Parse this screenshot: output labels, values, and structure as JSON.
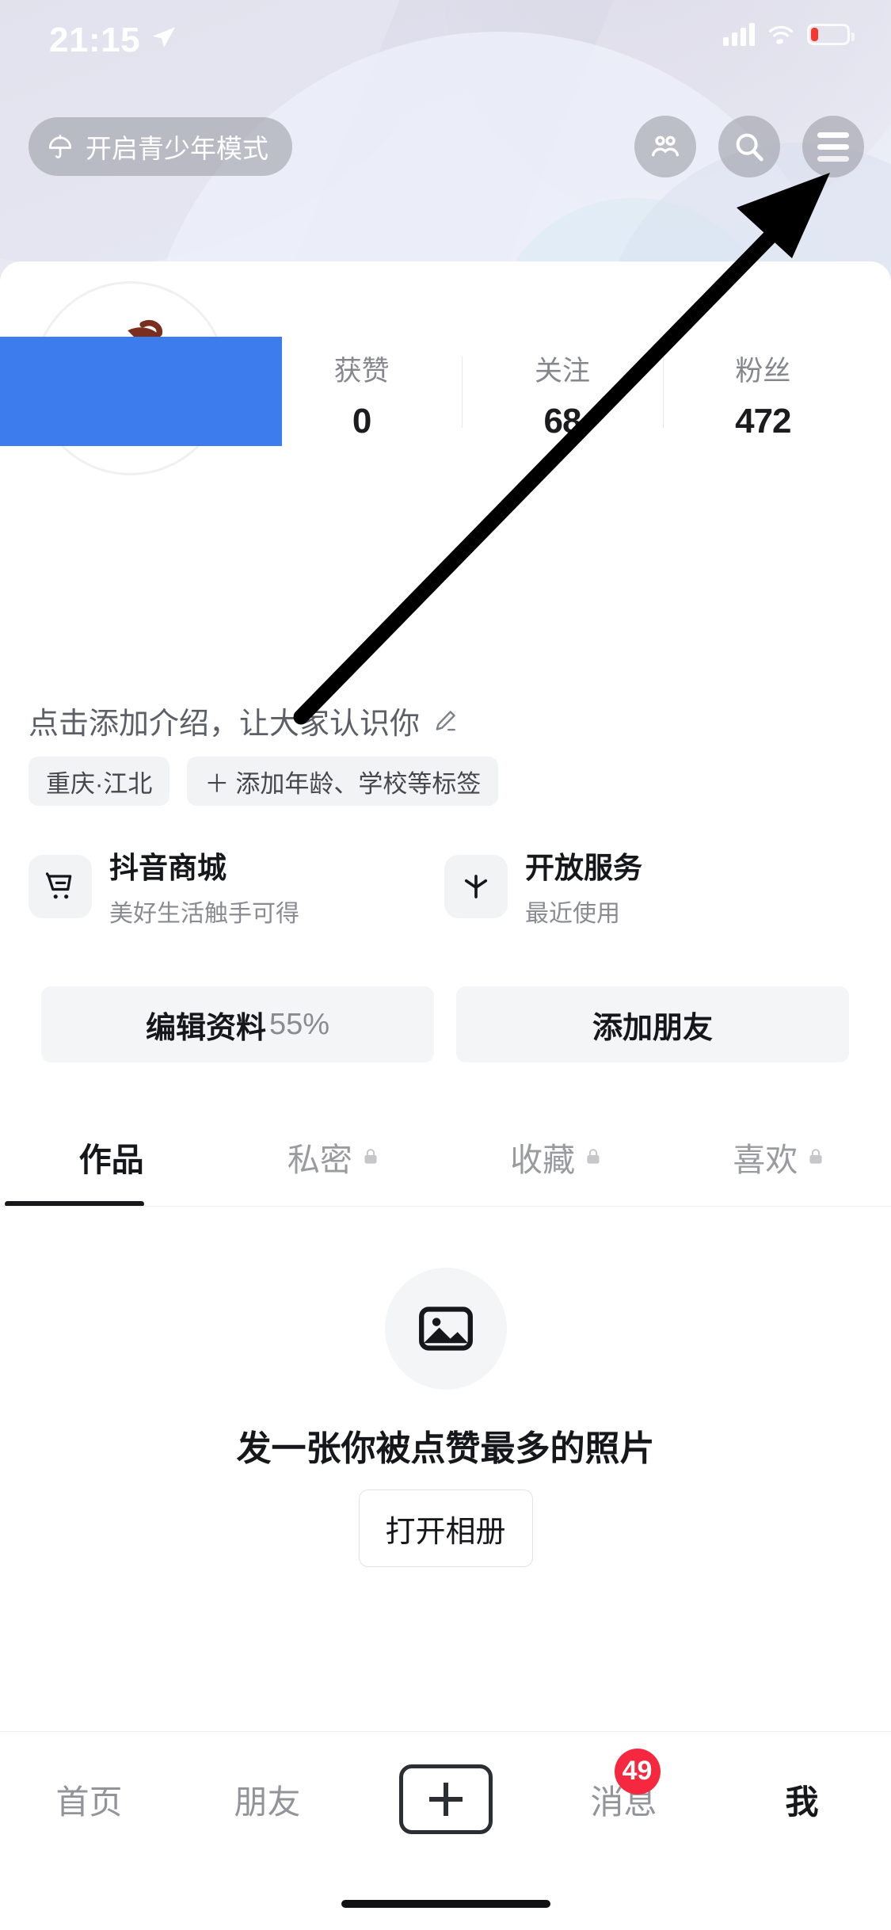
{
  "status_bar": {
    "time": "21:15",
    "location_icon": "location-arrow-icon",
    "signal_icon": "cellular-signal-icon",
    "wifi_icon": "wifi-icon",
    "battery_icon": "battery-low-icon",
    "battery_color": "#f5382e"
  },
  "header": {
    "teen_mode_label": "开启青少年模式",
    "teen_mode_icon": "umbrella-icon",
    "buttons": [
      {
        "name": "friends-icon",
        "label": ""
      },
      {
        "name": "search-icon",
        "label": ""
      },
      {
        "name": "menu-icon",
        "label": ""
      }
    ]
  },
  "profile": {
    "avatar_alt": "user-avatar",
    "nickname_redacted": true,
    "stats": [
      {
        "label": "获赞",
        "value": "0"
      },
      {
        "label": "关注",
        "value": "68"
      },
      {
        "label": "粉丝",
        "value": "472"
      }
    ],
    "bio_placeholder": "点击添加介绍，让大家认识你",
    "bio_edit_icon": "pencil-icon",
    "tags": [
      {
        "label": "重庆·江北",
        "plus": false
      },
      {
        "label": "添加年龄、学校等标签",
        "plus": true
      }
    ]
  },
  "services": [
    {
      "icon": "shopping-cart-icon",
      "title": "抖音商城",
      "subtitle": "美好生活触手可得"
    },
    {
      "icon": "open-service-icon",
      "title": "开放服务",
      "subtitle": "最近使用"
    }
  ],
  "actions": {
    "edit_profile_label": "编辑资料",
    "edit_profile_percent": "55%",
    "add_friend_label": "添加朋友"
  },
  "content_tabs": [
    {
      "label": "作品",
      "locked": false,
      "active": true
    },
    {
      "label": "私密",
      "locked": true,
      "active": false
    },
    {
      "label": "收藏",
      "locked": true,
      "active": false
    },
    {
      "label": "喜欢",
      "locked": true,
      "active": false
    }
  ],
  "empty_state": {
    "icon": "photo-placeholder-icon",
    "title": "发一张你被点赞最多的照片",
    "button_label": "打开相册"
  },
  "bottom_nav": [
    {
      "label": "首页",
      "active": false,
      "badge": ""
    },
    {
      "label": "朋友",
      "active": false,
      "badge": ""
    },
    {
      "label": "",
      "active": false,
      "badge": "",
      "icon": "plus-create-icon"
    },
    {
      "label": "消息",
      "active": false,
      "badge": "49"
    },
    {
      "label": "我",
      "active": true,
      "badge": ""
    }
  ],
  "annotation": {
    "arrow": "pointer-arrow-to-menu-icon",
    "color": "#000000"
  },
  "colors": {
    "redaction_blue": "#3d7cec",
    "badge_red": "#f5283f",
    "accent_cyan": "#2ad6e4",
    "accent_pink": "#fe2c55"
  }
}
